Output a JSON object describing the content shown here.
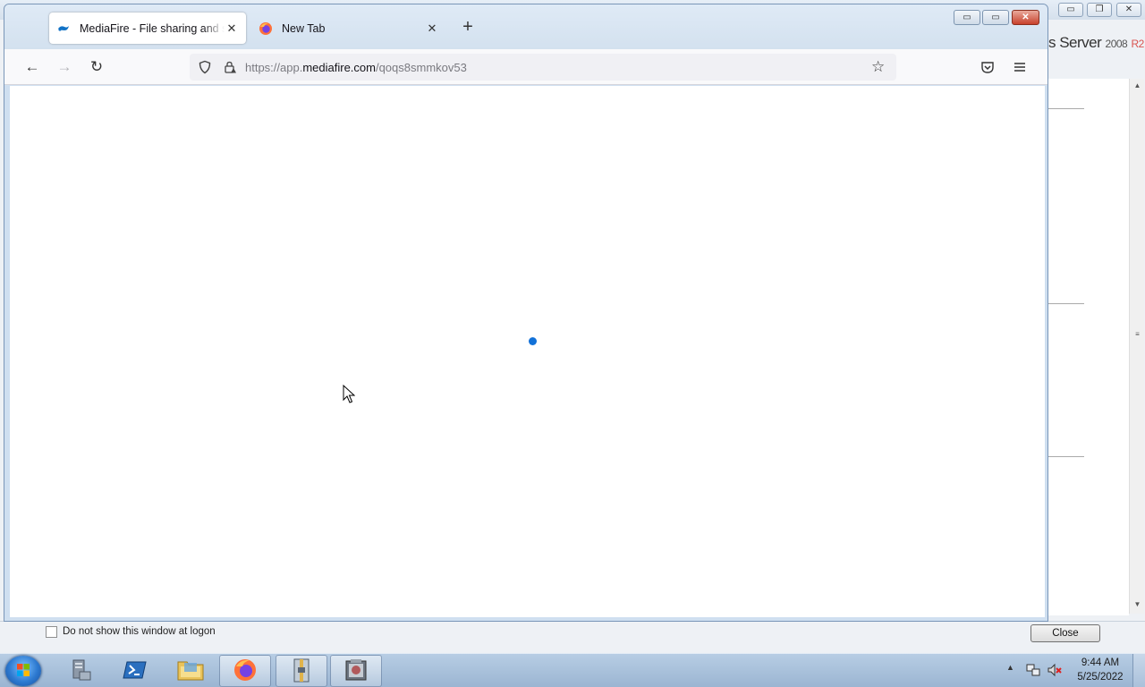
{
  "background_window": {
    "brand_server": "s Server",
    "brand_year": "2008",
    "brand_release": "R2",
    "minimize": "▭",
    "restore": "❐",
    "close": "✕",
    "logon_checkbox_label": "Do not show this window at logon",
    "logon_checkbox_checked": false,
    "close_button_label": "Close"
  },
  "browser": {
    "tabs": [
      {
        "title": "MediaFire - File sharing and storage",
        "favicon": "mediafire-icon",
        "active": true,
        "close": "✕"
      },
      {
        "title": "New Tab",
        "favicon": "firefox-icon",
        "active": false,
        "close": "✕"
      }
    ],
    "new_tab": "+",
    "window_controls": {
      "minimize": "▭",
      "maximize": "▭",
      "close": "✕"
    },
    "nav": {
      "back": "←",
      "forward": "→",
      "reload": "↻"
    },
    "url": {
      "prefix": "https://app.",
      "domain": "mediafire.com",
      "path": "/qoqs8smmkov53"
    },
    "bookmark": "☆",
    "content_state": "loading",
    "accent_color": "#1271d8"
  },
  "taskbar": {
    "apps": [
      {
        "name": "server-manager",
        "active": false
      },
      {
        "name": "powershell",
        "active": false
      },
      {
        "name": "file-explorer",
        "active": false
      },
      {
        "name": "firefox",
        "active": true
      },
      {
        "name": "archive-tool",
        "active": true
      },
      {
        "name": "disk-tool",
        "active": true
      }
    ],
    "clock_time": "9:44 AM",
    "clock_date": "5/25/2022"
  }
}
